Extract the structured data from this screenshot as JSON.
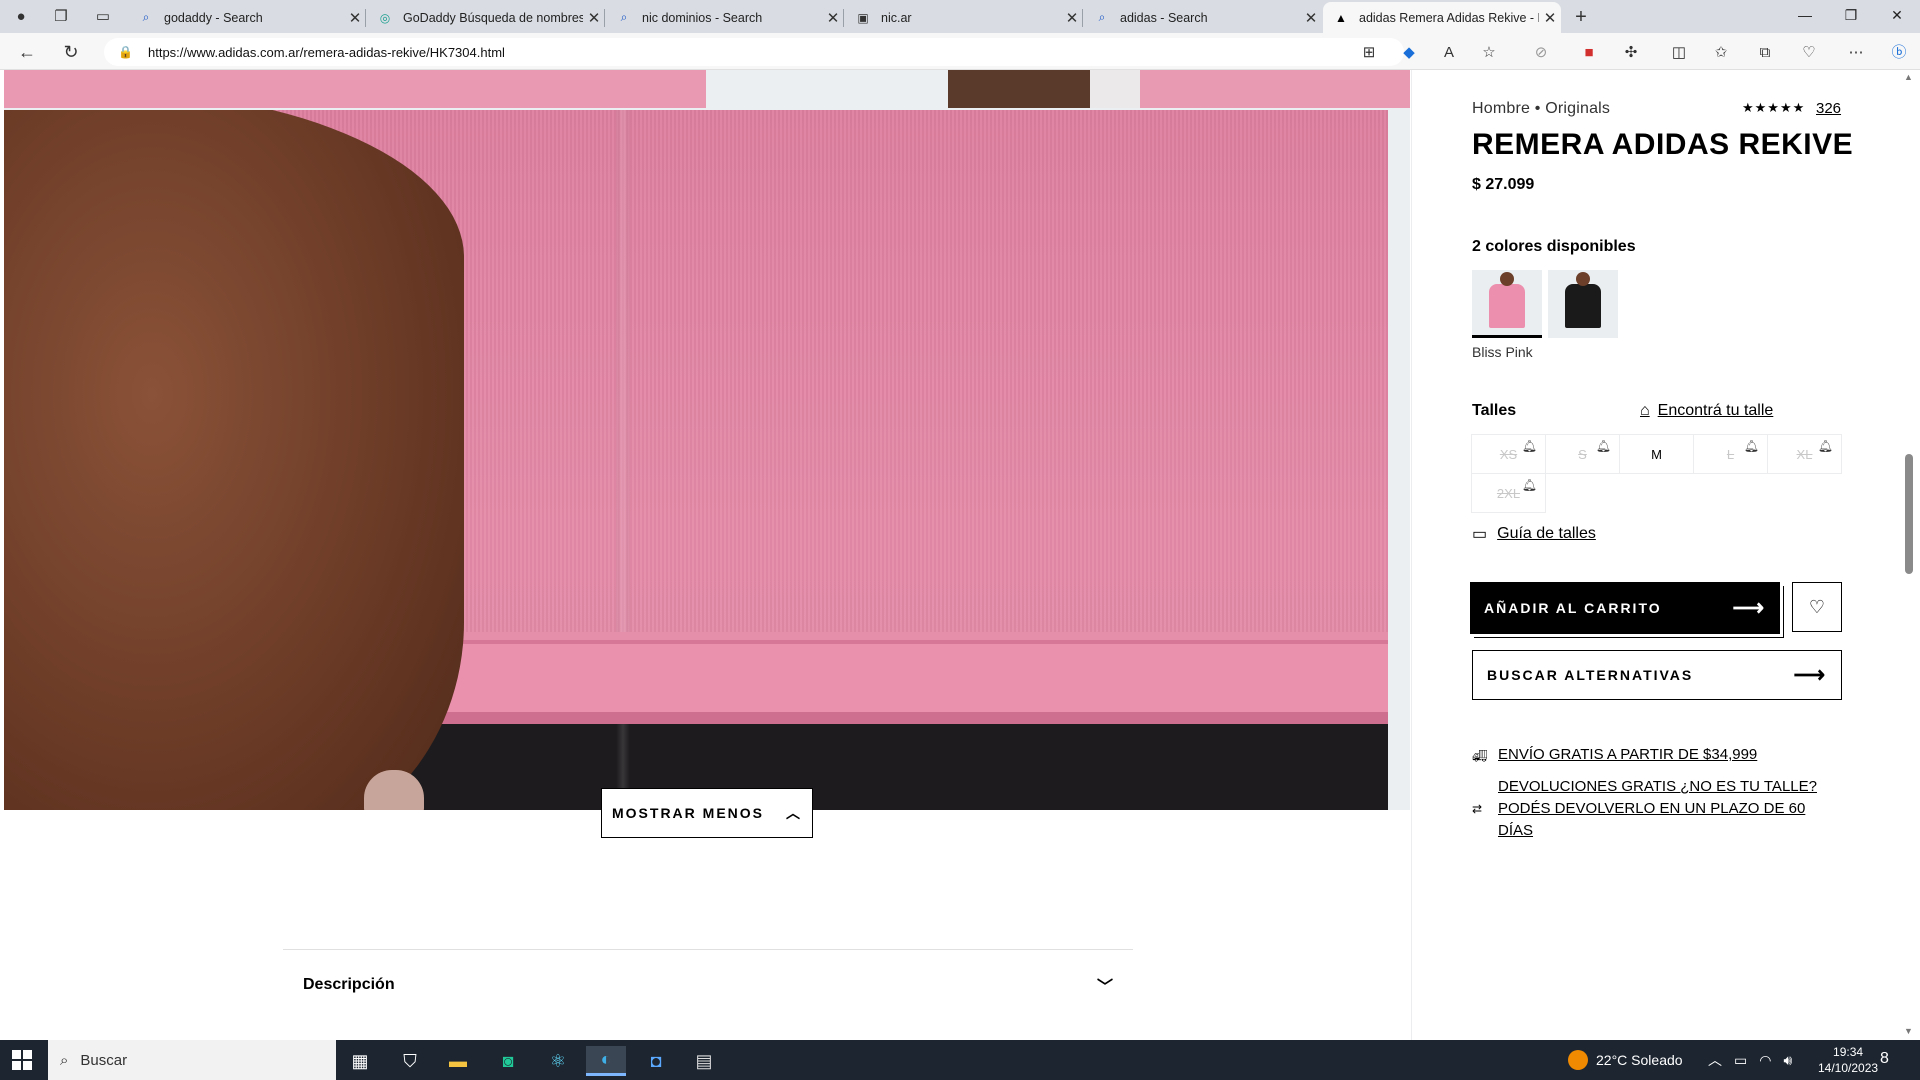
{
  "browser": {
    "tabs": [
      {
        "title": "godaddy - Search",
        "icon": "search-icon",
        "active": false
      },
      {
        "title": "GoDaddy Búsqueda de nombres de dominio",
        "icon": "godaddy-icon",
        "active": false
      },
      {
        "title": "nic dominios - Search",
        "icon": "search-icon",
        "active": false
      },
      {
        "title": "nic.ar",
        "icon": "page-icon",
        "active": false
      },
      {
        "title": "adidas - Search",
        "icon": "search-icon",
        "active": false
      },
      {
        "title": "adidas Remera Adidas Rekive - Rosa",
        "icon": "adidas-icon",
        "active": true
      }
    ],
    "new_tab": "+",
    "url": "https://www.adidas.com.ar/remera-adidas-rekive/HK7304.html"
  },
  "product": {
    "breadcrumb": "Hombre • Originals",
    "stars": "★★★★★",
    "reviews": "326",
    "title": "REMERA ADIDAS REKIVE",
    "price": "$ 27.099",
    "colors_heading": "2 colores disponibles",
    "selected_color": "Bliss Pink",
    "sizes_heading": "Talles",
    "size_finder": "Encontrá tu talle",
    "sizes": [
      {
        "label": "XS",
        "available": false
      },
      {
        "label": "S",
        "available": false
      },
      {
        "label": "M",
        "available": true
      },
      {
        "label": "L",
        "available": false
      },
      {
        "label": "XL",
        "available": false
      },
      {
        "label": "2XL",
        "available": false
      }
    ],
    "size_guide": "Guía de talles",
    "add_to_cart": "AÑADIR AL CARRITO",
    "find_alternatives": "BUSCAR ALTERNATIVAS",
    "shipping": "ENVÍO GRATIS A PARTIR DE $34,999",
    "returns": "DEVOLUCIONES GRATIS ¿NO ES TU TALLE? PODÉS DEVOLVERLO EN UN PLAZO DE 60 DÍAS"
  },
  "gallery": {
    "show_less": "MOSTRAR MENOS"
  },
  "description": {
    "heading": "Descripción"
  },
  "taskbar": {
    "search_placeholder": "Buscar",
    "weather": "22°C  Soleado",
    "time": "19:34",
    "date": "14/10/2023",
    "notifications": "8"
  },
  "colors": {
    "swatch_pink": "#ec8fae",
    "swatch_black": "#1a1a1a"
  }
}
